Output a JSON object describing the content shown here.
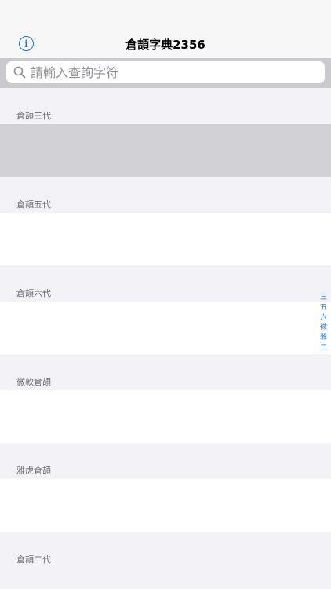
{
  "nav": {
    "info_glyph": "i",
    "title": "倉頡字典2356"
  },
  "search": {
    "placeholder": "請輸入查詢字符",
    "icon": "search-icon"
  },
  "sections": [
    {
      "header": "倉頡三代",
      "selected": true
    },
    {
      "header": "倉頡五代",
      "selected": false
    },
    {
      "header": "倉頡六代",
      "selected": false
    },
    {
      "header": "微軟倉頡",
      "selected": false
    },
    {
      "header": "雅虎倉頡",
      "selected": false
    },
    {
      "header": "倉頡二代",
      "selected": false
    }
  ],
  "index_bar": [
    "三",
    "五",
    "六",
    "微",
    "雅",
    "二"
  ],
  "colors": {
    "accent": "#1a73e8",
    "selected_row": "#d1d1d6",
    "search_bar_bg": "#c9c9ce"
  }
}
